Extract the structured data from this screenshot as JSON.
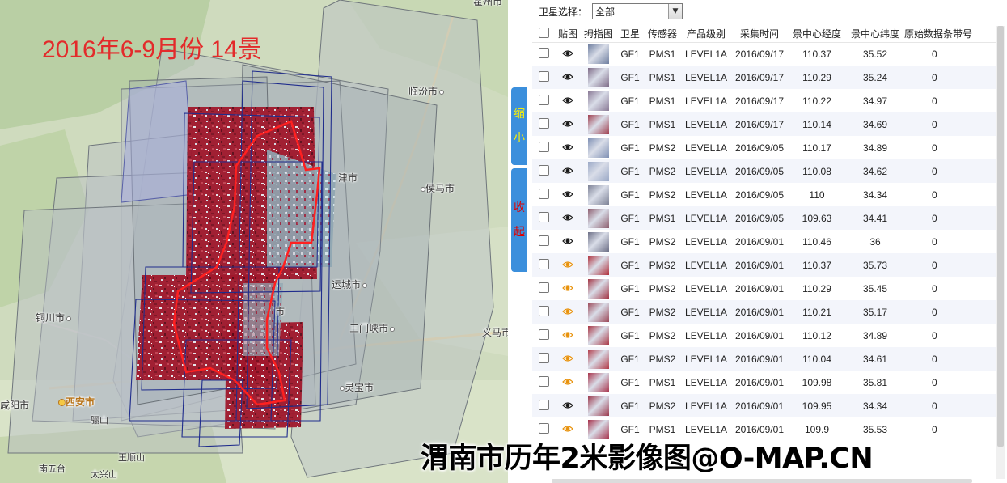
{
  "map": {
    "title": "2016年6-9月份 14景",
    "cities": [
      {
        "name": "临汾市",
        "kind": "city"
      },
      {
        "name": "侯马市",
        "kind": "city"
      },
      {
        "name": "运城市",
        "kind": "city"
      },
      {
        "name": "三门峡市",
        "kind": "city"
      },
      {
        "name": "义马市",
        "kind": "city"
      },
      {
        "name": "灵宝市",
        "kind": "city"
      },
      {
        "name": "铜川市",
        "kind": "city"
      },
      {
        "name": "咸阳市",
        "kind": "city"
      },
      {
        "name": "西安市",
        "kind": "capital"
      },
      {
        "name": "骊山",
        "kind": "small"
      },
      {
        "name": "王顺山",
        "kind": "small"
      },
      {
        "name": "南五台",
        "kind": "small"
      },
      {
        "name": "太兴山",
        "kind": "small"
      },
      {
        "name": "霍州市",
        "kind": "city"
      },
      {
        "name": "津市",
        "kind": "city"
      },
      {
        "name": "市",
        "kind": "city"
      }
    ]
  },
  "tabs": {
    "shrink": [
      "缩",
      "小"
    ],
    "collapse": [
      "收",
      "起"
    ]
  },
  "panel": {
    "filter_label": "卫星选择：",
    "filter_value": "全部",
    "columns": [
      "",
      "贴图",
      "拇指图",
      "卫星",
      "传感器",
      "产品级别",
      "采集时间",
      "景中心经度",
      "景中心纬度",
      "原始数据条带号"
    ],
    "rows": [
      {
        "eye": "dark",
        "thumb": "#6f7fa0",
        "sat": "GF1",
        "sensor": "PMS1",
        "level": "LEVEL1A",
        "date": "2016/09/17",
        "lon": "110.37",
        "lat": "35.52",
        "strip": "0"
      },
      {
        "eye": "dark",
        "thumb": "#7d6a86",
        "sat": "GF1",
        "sensor": "PMS1",
        "level": "LEVEL1A",
        "date": "2016/09/17",
        "lon": "110.29",
        "lat": "35.24",
        "strip": "0"
      },
      {
        "eye": "dark",
        "thumb": "#8a7a96",
        "sat": "GF1",
        "sensor": "PMS1",
        "level": "LEVEL1A",
        "date": "2016/09/17",
        "lon": "110.22",
        "lat": "34.97",
        "strip": "0"
      },
      {
        "eye": "dark",
        "thumb": "#a04050",
        "sat": "GF1",
        "sensor": "PMS1",
        "level": "LEVEL1A",
        "date": "2016/09/17",
        "lon": "110.14",
        "lat": "34.69",
        "strip": "0"
      },
      {
        "eye": "dark",
        "thumb": "#7f90b4",
        "sat": "GF1",
        "sensor": "PMS2",
        "level": "LEVEL1A",
        "date": "2016/09/05",
        "lon": "110.17",
        "lat": "34.89",
        "strip": "0"
      },
      {
        "eye": "dark",
        "thumb": "#9aa8c6",
        "sat": "GF1",
        "sensor": "PMS2",
        "level": "LEVEL1A",
        "date": "2016/09/05",
        "lon": "110.08",
        "lat": "34.62",
        "strip": "0"
      },
      {
        "eye": "dark",
        "thumb": "#7d8296",
        "sat": "GF1",
        "sensor": "PMS2",
        "level": "LEVEL1A",
        "date": "2016/09/05",
        "lon": "110",
        "lat": "34.34",
        "strip": "0"
      },
      {
        "eye": "dark",
        "thumb": "#8c5d6e",
        "sat": "GF1",
        "sensor": "PMS1",
        "level": "LEVEL1A",
        "date": "2016/09/05",
        "lon": "109.63",
        "lat": "34.41",
        "strip": "0"
      },
      {
        "eye": "dark",
        "thumb": "#6c6f86",
        "sat": "GF1",
        "sensor": "PMS2",
        "level": "LEVEL1A",
        "date": "2016/09/01",
        "lon": "110.46",
        "lat": "36",
        "strip": "0"
      },
      {
        "eye": "orange",
        "thumb": "#b0303c",
        "sat": "GF1",
        "sensor": "PMS2",
        "level": "LEVEL1A",
        "date": "2016/09/01",
        "lon": "110.37",
        "lat": "35.73",
        "strip": "0"
      },
      {
        "eye": "orange",
        "thumb": "#a33645",
        "sat": "GF1",
        "sensor": "PMS2",
        "level": "LEVEL1A",
        "date": "2016/09/01",
        "lon": "110.29",
        "lat": "35.45",
        "strip": "0"
      },
      {
        "eye": "orange",
        "thumb": "#9b4656",
        "sat": "GF1",
        "sensor": "PMS2",
        "level": "LEVEL1A",
        "date": "2016/09/01",
        "lon": "110.21",
        "lat": "35.17",
        "strip": "0"
      },
      {
        "eye": "orange",
        "thumb": "#a83442",
        "sat": "GF1",
        "sensor": "PMS2",
        "level": "LEVEL1A",
        "date": "2016/09/01",
        "lon": "110.12",
        "lat": "34.89",
        "strip": "0"
      },
      {
        "eye": "orange",
        "thumb": "#b23a48",
        "sat": "GF1",
        "sensor": "PMS2",
        "level": "LEVEL1A",
        "date": "2016/09/01",
        "lon": "110.04",
        "lat": "34.61",
        "strip": "0"
      },
      {
        "eye": "orange",
        "thumb": "#a8324a",
        "sat": "GF1",
        "sensor": "PMS1",
        "level": "LEVEL1A",
        "date": "2016/09/01",
        "lon": "109.98",
        "lat": "35.81",
        "strip": "0"
      },
      {
        "eye": "dark",
        "thumb": "#9c3a4e",
        "sat": "GF1",
        "sensor": "PMS2",
        "level": "LEVEL1A",
        "date": "2016/09/01",
        "lon": "109.95",
        "lat": "34.34",
        "strip": "0"
      },
      {
        "eye": "orange",
        "thumb": "#a6304a",
        "sat": "GF1",
        "sensor": "PMS1",
        "level": "LEVEL1A",
        "date": "2016/09/01",
        "lon": "109.9",
        "lat": "35.53",
        "strip": "0"
      }
    ]
  },
  "watermark": "渭南市历年2米影像图@O-MAP.CN",
  "colors": {
    "accent": "#3b8fdc",
    "footprint": "#1f2c8c",
    "boundary": "#ff2020",
    "title": "#e32b2b"
  }
}
